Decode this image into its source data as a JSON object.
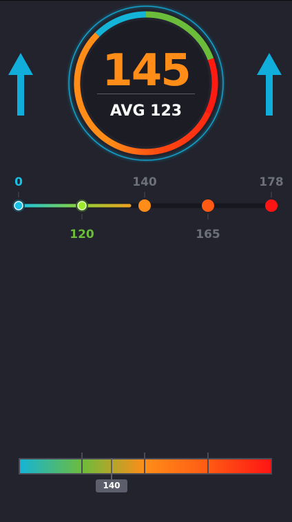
{
  "gauge": {
    "value": "145",
    "average_text": "AVG 123",
    "segment_colors": [
      "#14b4d8",
      "#6cbc3c",
      "#ff1a12",
      "#ff5a14",
      "#ff8d18"
    ]
  },
  "zones": {
    "upper_labels": [
      "0",
      "140",
      "178"
    ],
    "lower_labels": [
      "120",
      "165"
    ],
    "colors": {
      "zone1": "#17c2e6",
      "zone2": "#9bea2c",
      "zone3": "#ff8d18",
      "zone4": "#ff5a14",
      "zone5": "#ff1414"
    }
  },
  "scale": {
    "marker_value": "140"
  }
}
